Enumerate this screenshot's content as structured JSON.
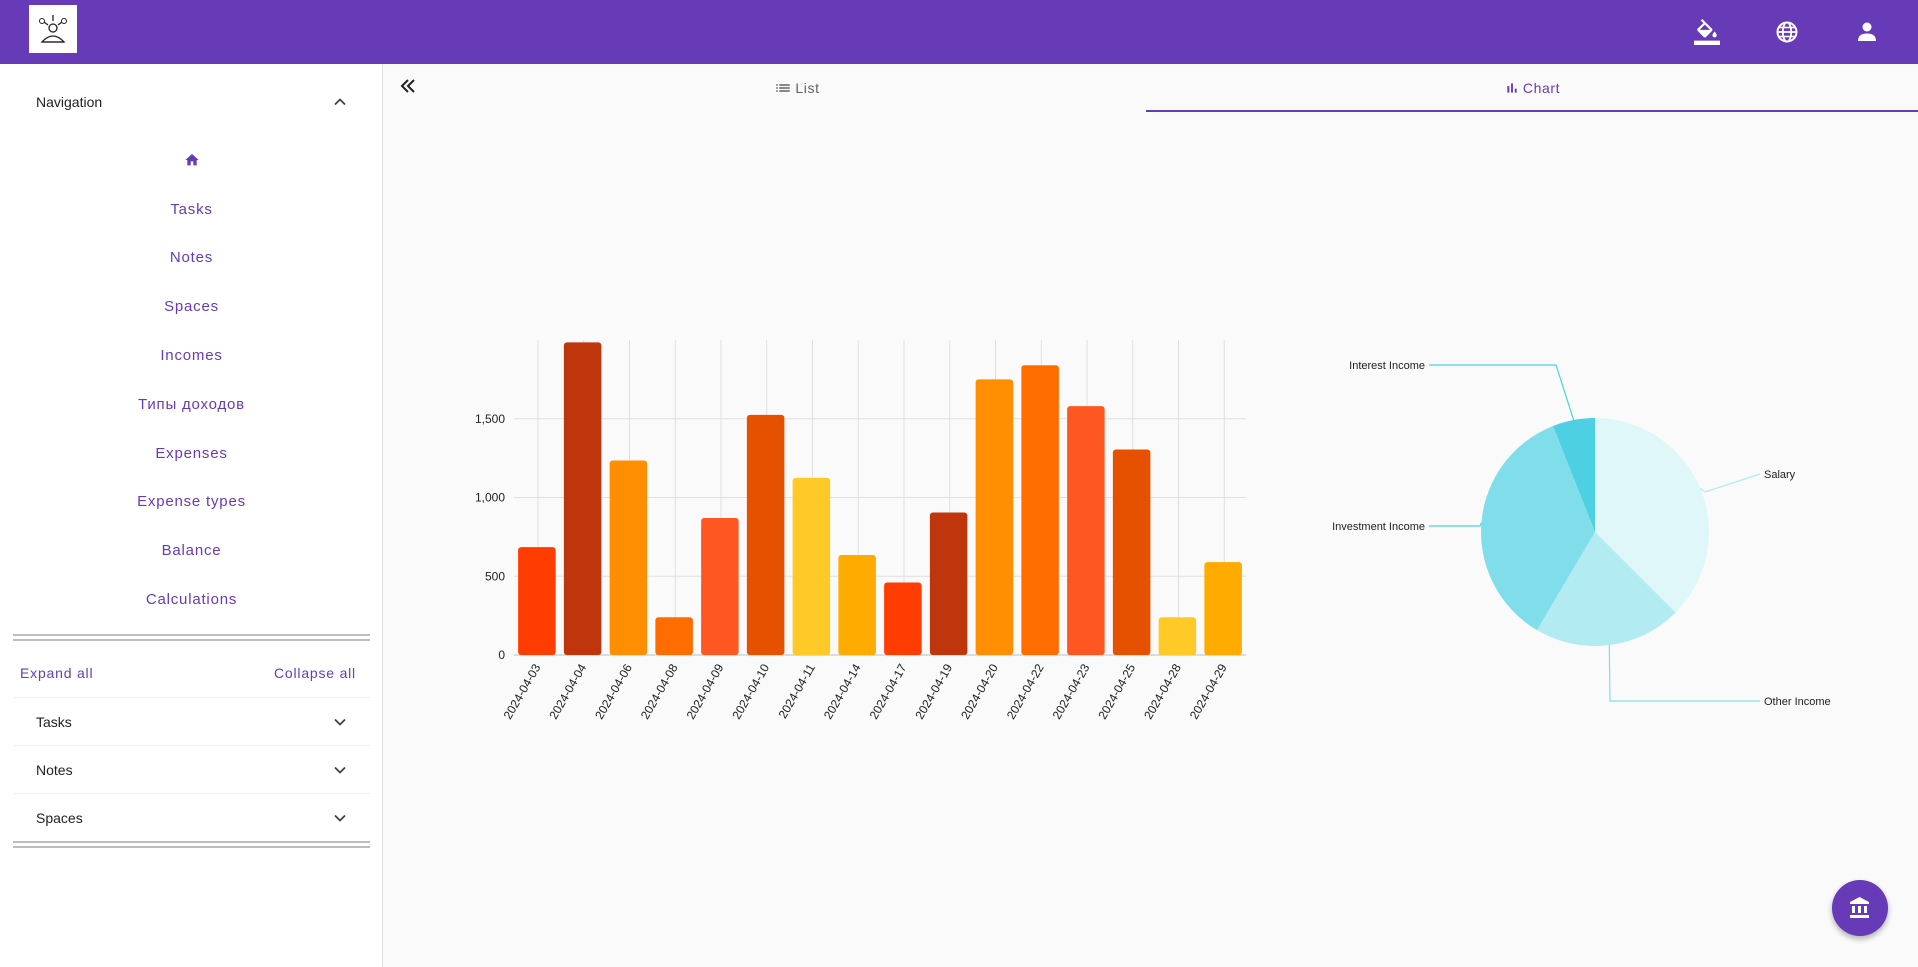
{
  "header": {
    "icons": [
      "logo-icon",
      "paint-bucket-icon",
      "globe-icon",
      "person-icon"
    ]
  },
  "sidebar": {
    "navigation_label": "Navigation",
    "items": [
      {
        "label": "",
        "icon": "home-icon"
      },
      {
        "label": "Tasks"
      },
      {
        "label": "Notes"
      },
      {
        "label": "Spaces"
      },
      {
        "label": "Incomes"
      },
      {
        "label": "Типы доходов"
      },
      {
        "label": "Expenses"
      },
      {
        "label": "Expense types"
      },
      {
        "label": "Balance"
      },
      {
        "label": "Calculations"
      }
    ],
    "expand_all": "Expand all",
    "collapse_all": "Collapse all",
    "panels": [
      {
        "label": "Tasks"
      },
      {
        "label": "Notes"
      },
      {
        "label": "Spaces"
      }
    ]
  },
  "tabs": {
    "list_label": "List",
    "chart_label": "Chart",
    "active": "Chart"
  },
  "fab": {
    "icon": "bank-icon"
  },
  "colors": {
    "primary": "#673ab7",
    "bar_palette": [
      "#ff3d00",
      "#bf360c",
      "#ff8f00",
      "#ff6d00",
      "#ff5722",
      "#e65100",
      "#ffca28",
      "#ffab00",
      "#ff3d00",
      "#bf360c",
      "#ff8f00",
      "#ff6d00",
      "#ff5722",
      "#e65100",
      "#ffca28",
      "#ffab00"
    ],
    "pie_palette": [
      "#e0f7fa",
      "#b2ebf2",
      "#80deea",
      "#4dd0e1"
    ]
  },
  "chart_data": [
    {
      "type": "bar",
      "categories": [
        "2024-04-03",
        "2024-04-04",
        "2024-04-06",
        "2024-04-08",
        "2024-04-09",
        "2024-04-10",
        "2024-04-11",
        "2024-04-14",
        "2024-04-17",
        "2024-04-19",
        "2024-04-20",
        "2024-04-22",
        "2024-04-23",
        "2024-04-25",
        "2024-04-28",
        "2024-04-29"
      ],
      "values": [
        685,
        1985,
        1235,
        240,
        870,
        1525,
        1125,
        635,
        460,
        905,
        1750,
        1840,
        1580,
        1305,
        240,
        590
      ],
      "yticks": [
        "0",
        "500",
        "1,000",
        "1,500"
      ],
      "ylim": [
        0,
        2000
      ],
      "grid": true
    },
    {
      "type": "pie",
      "categories": [
        "Salary",
        "Other Income",
        "Investment Income",
        "Interest Income"
      ],
      "values": [
        37.5,
        21,
        35.5,
        6
      ]
    }
  ]
}
